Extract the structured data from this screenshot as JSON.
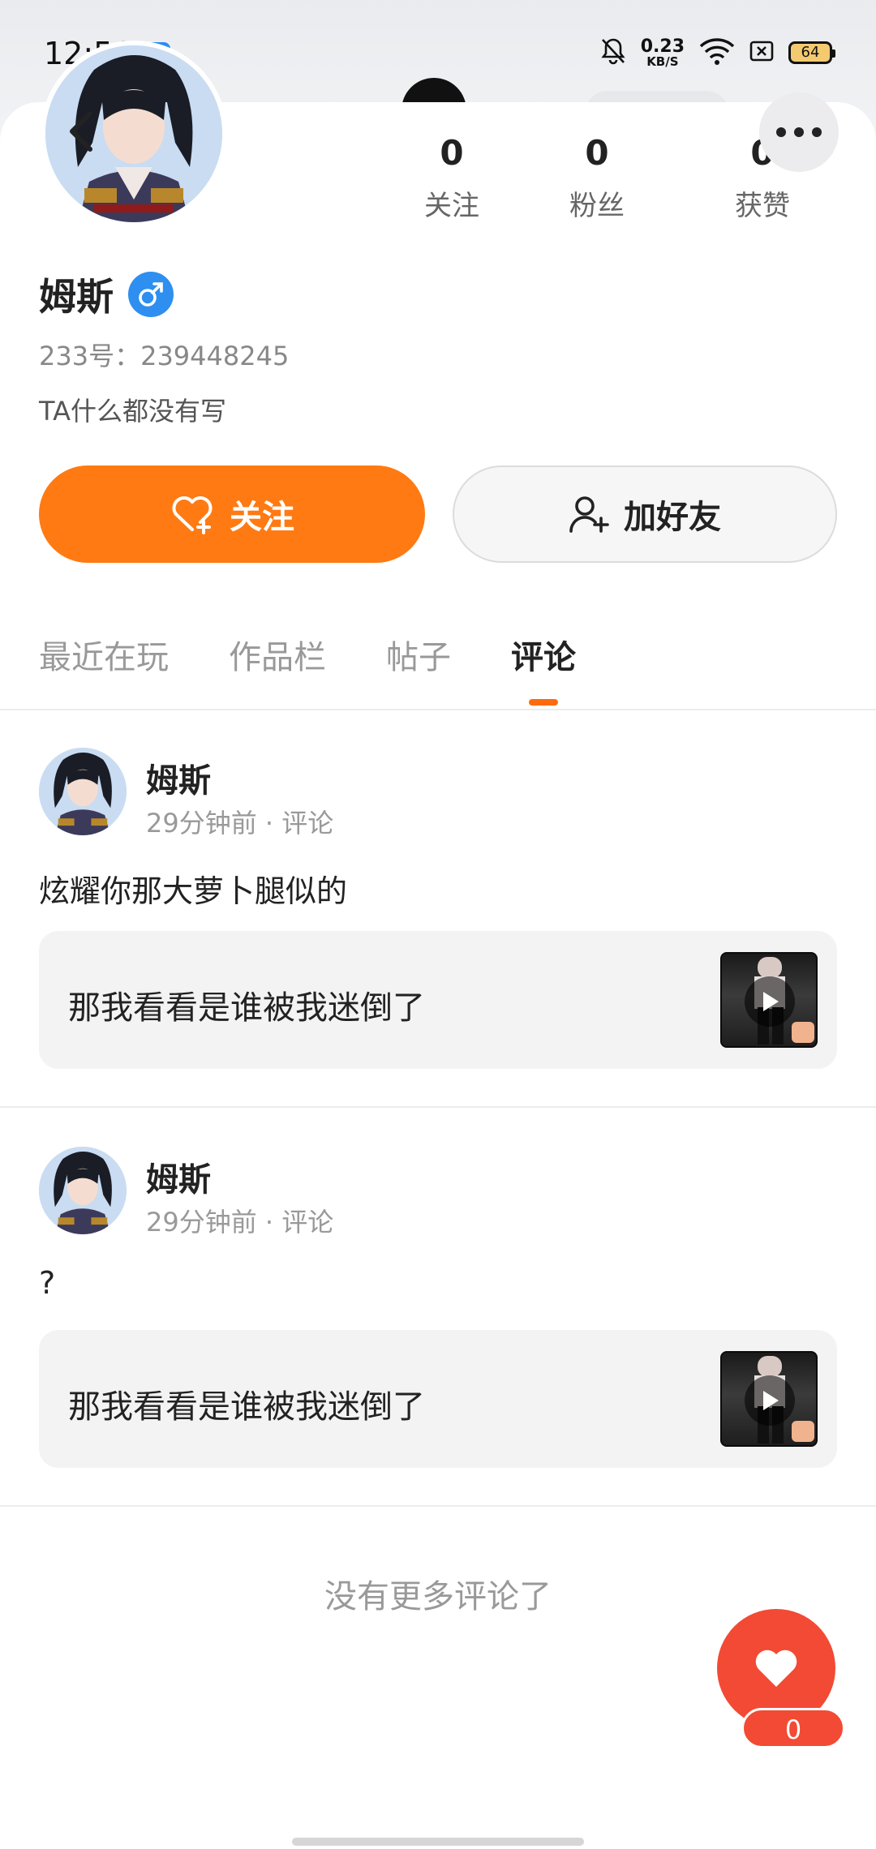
{
  "status_bar": {
    "time": "12:56",
    "net_speed_value": "0.23",
    "net_speed_unit": "KB/S",
    "battery": "64",
    "icons": [
      "q-app-icon",
      "bell-off-icon",
      "wifi-icon",
      "sim-x-icon",
      "battery-icon"
    ]
  },
  "profile": {
    "name": "姆斯",
    "account_id": "233号：239448245",
    "bio": "TA什么都没有写",
    "gender_color": "#2e8ff0",
    "stats": [
      {
        "value": "0",
        "label": "关注"
      },
      {
        "value": "0",
        "label": "粉丝"
      },
      {
        "value": "0",
        "label": "获赞"
      }
    ]
  },
  "actions": {
    "follow_label": "关注",
    "follow_color": "#ff7a12",
    "add_friend_label": "加好友"
  },
  "tabs": [
    {
      "label": "最近在玩",
      "active": false
    },
    {
      "label": "作品栏",
      "active": false
    },
    {
      "label": "帖子",
      "active": false
    },
    {
      "label": "评论",
      "active": true
    }
  ],
  "comments": [
    {
      "author": "姆斯",
      "meta": "29分钟前 · 评论",
      "text": "炫耀你那大萝卜腿似的",
      "ref_text": "那我看看是谁被我迷倒了"
    },
    {
      "author": "姆斯",
      "meta": "29分钟前 · 评论",
      "text": "?",
      "ref_text": "那我看看是谁被我迷倒了"
    }
  ],
  "footer": {
    "no_more": "没有更多评论了",
    "like_count": "0",
    "like_color": "#f24a34"
  }
}
